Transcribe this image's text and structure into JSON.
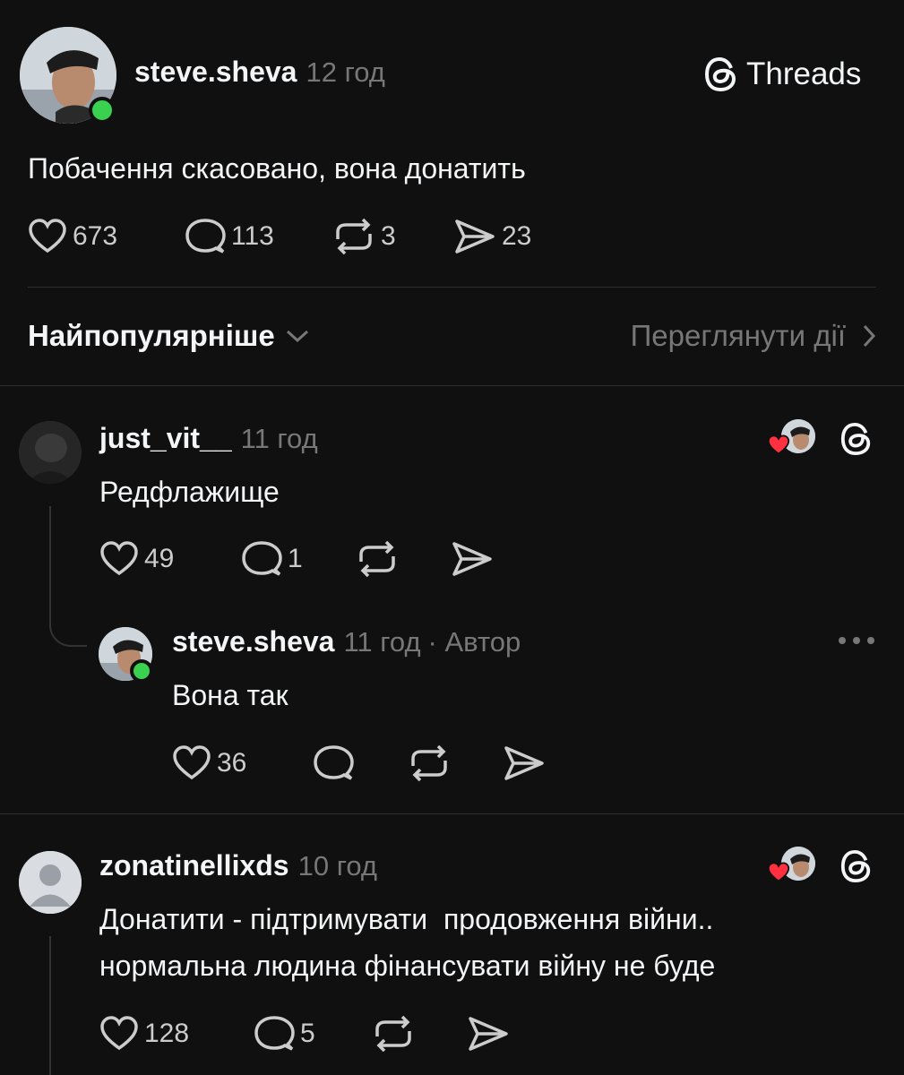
{
  "post": {
    "author": "steve.sheva",
    "time": "12 год",
    "brand": "Threads",
    "text": "Побачення скасовано, вона донатить",
    "stats": {
      "likes": "673",
      "comments": "113",
      "reposts": "3",
      "shares": "23"
    }
  },
  "filter": {
    "sort_label": "Найпопулярніше",
    "activity_label": "Переглянути дії"
  },
  "comments": [
    {
      "author": "just_vit__",
      "time": "11 год",
      "text": "Редфлажище",
      "stats": {
        "likes": "49",
        "comments": "1"
      }
    },
    {
      "author": "steve.sheva",
      "time": "11 год",
      "author_tag": "· Автор",
      "text": "Вона так",
      "stats": {
        "likes": "36"
      }
    },
    {
      "author": "zonatinellixds",
      "time": "10 год",
      "text_line1": "Донатити - підтримувати  продовження війни..",
      "text_line2": "нормальна людина фінансувати війну не буде",
      "stats": {
        "likes": "128",
        "comments": "5"
      }
    }
  ],
  "colors": {
    "background": "#101010",
    "online": "#3ad150",
    "heart": "#ff3040"
  }
}
